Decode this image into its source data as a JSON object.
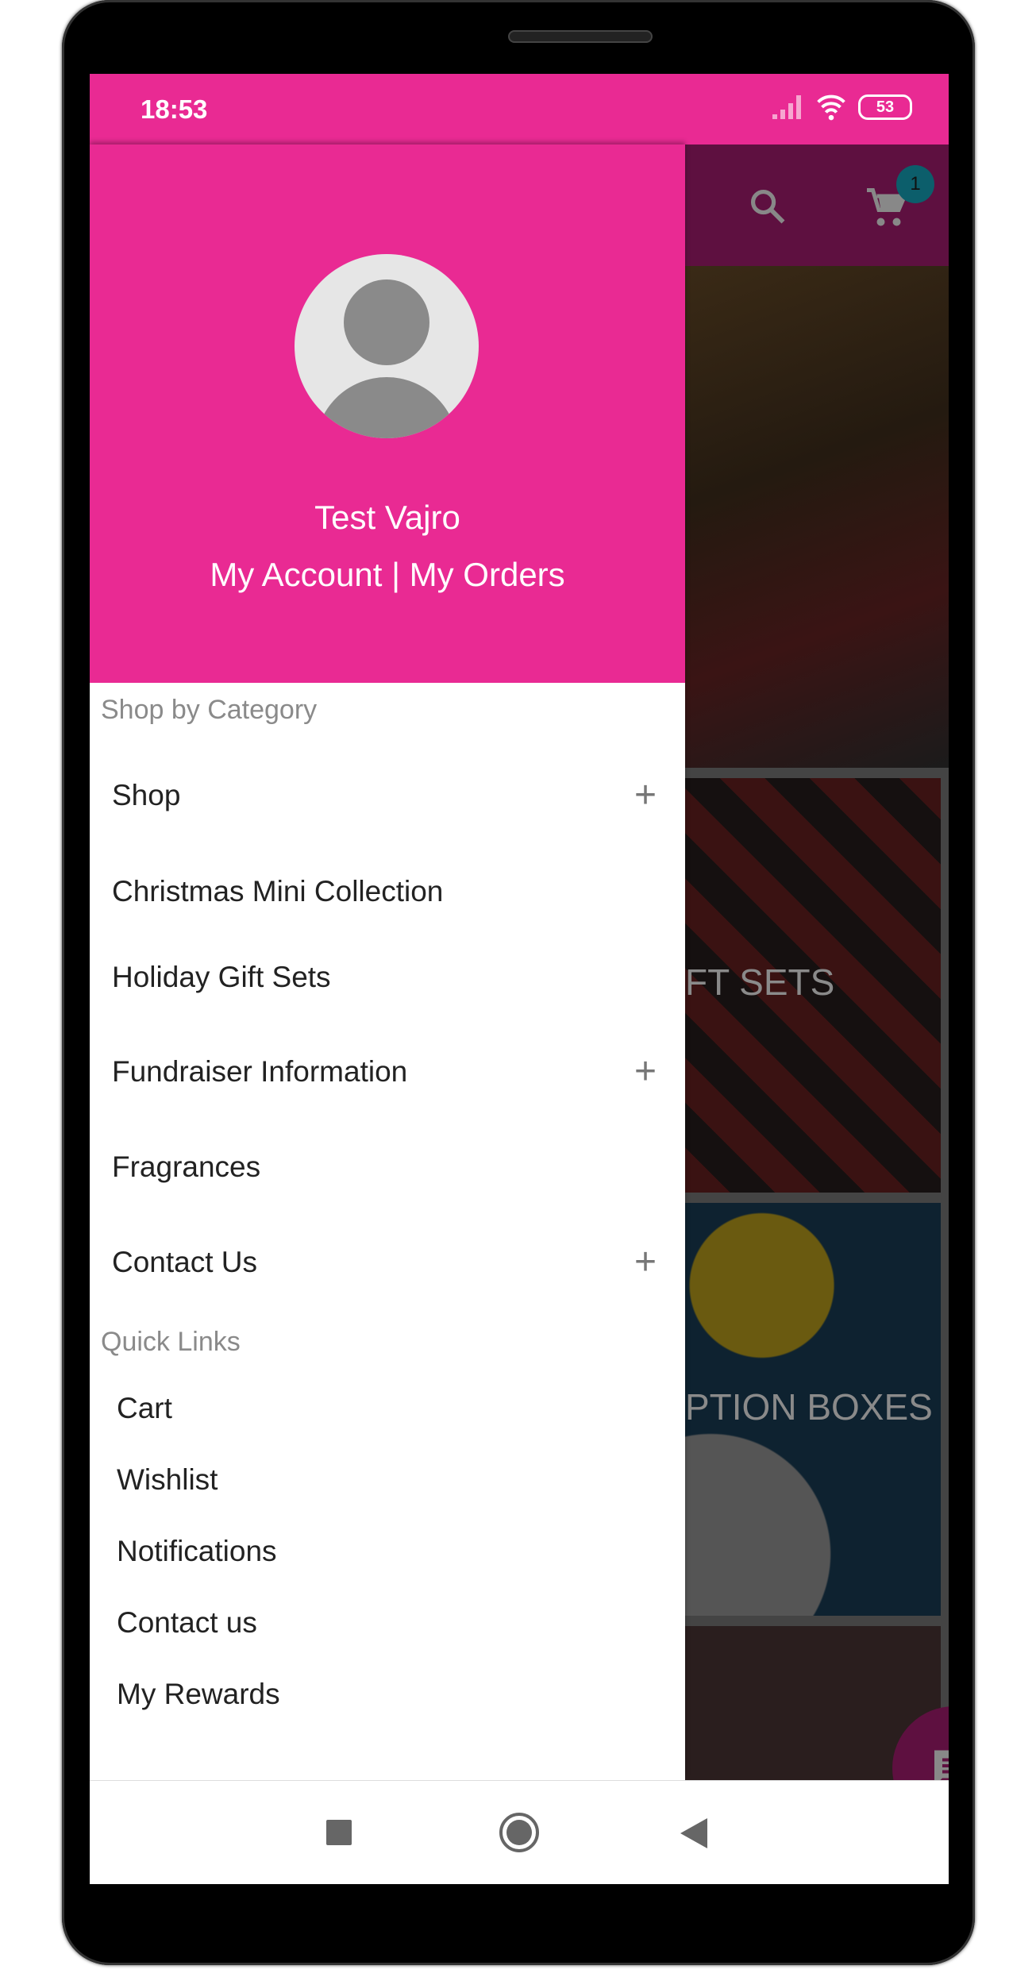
{
  "status_bar": {
    "time": "18:53",
    "battery": "53",
    "icons": [
      "signal-icon",
      "wifi-icon",
      "battery-icon"
    ]
  },
  "background": {
    "app_bar_icons": [
      "search-icon",
      "cart-icon"
    ],
    "cart_badge": "1",
    "banners": [
      "FT SETS",
      "PTION BOXES"
    ],
    "fab_icon": "chat-icon"
  },
  "drawer": {
    "user_name": "Test Vajro",
    "account_links": "My Account | My Orders",
    "section_category": "Shop by Category",
    "categories": [
      {
        "label": "Shop",
        "expandable": true
      },
      {
        "label": "Christmas Mini Collection",
        "expandable": false
      },
      {
        "label": "Holiday Gift Sets",
        "expandable": false
      },
      {
        "label": "Fundraiser Information",
        "expandable": true
      },
      {
        "label": "Fragrances",
        "expandable": false
      },
      {
        "label": "Contact Us",
        "expandable": true
      }
    ],
    "expand_symbol": "+",
    "section_quick": "Quick Links",
    "quick_links": [
      "Cart",
      "Wishlist",
      "Notifications",
      "Contact us",
      "My Rewards"
    ]
  },
  "colors": {
    "primary": "#e92a93",
    "primary_dim": "#5e1040",
    "badge": "#0c5e6b"
  },
  "nav_bar": [
    "recents-button",
    "home-button",
    "back-button"
  ]
}
